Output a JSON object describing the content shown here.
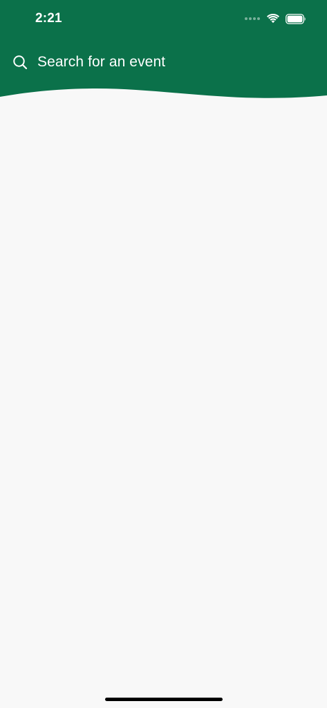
{
  "status_bar": {
    "time": "2:21"
  },
  "search": {
    "placeholder": "Search for an event"
  },
  "colors": {
    "header_green": "#0b714a",
    "background": "#f8f8f8",
    "text_on_header": "#ffffff"
  },
  "icons": {
    "search": "search-icon",
    "wifi": "wifi-icon",
    "battery": "battery-icon",
    "signal": "cellular-signal-icon"
  }
}
